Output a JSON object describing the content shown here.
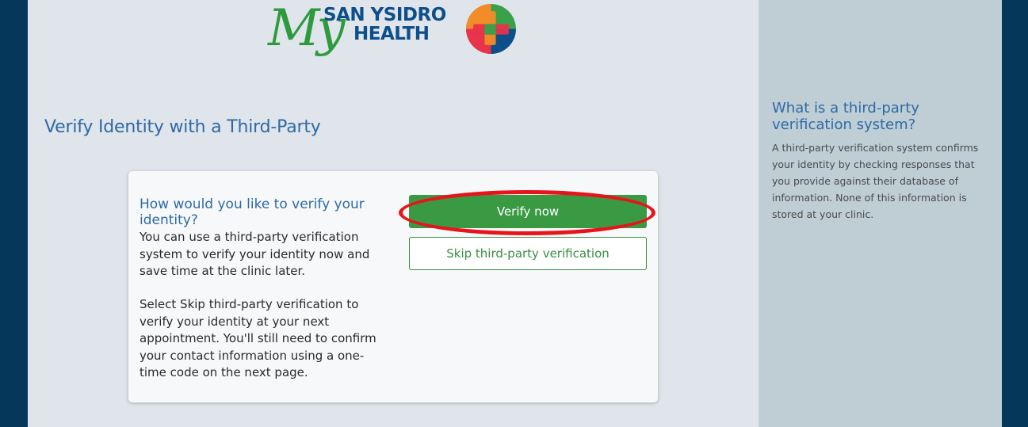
{
  "logo": {
    "my": "My",
    "line1": "SAN YSIDRO",
    "line2": "HEALTH",
    "badge_icon": "cross-badge-icon",
    "colors": {
      "green": "#2e9a3e",
      "blue": "#0d4f8b",
      "badge_red": "#e8334a",
      "badge_orange": "#f28c28",
      "badge_green": "#3aa14a",
      "badge_navy": "#0d4f8b"
    }
  },
  "main": {
    "title": "Verify Identity with a Third-Party",
    "card": {
      "heading": "How would you like to verify your identity?",
      "paragraph1": "You can use a third-party verification system to verify your identity now and save time at the clinic later.",
      "paragraph2": "Select Skip third-party verification to verify your identity at your next appointment. You'll still need to confirm your contact information using a one-time code on the next page.",
      "verify_label": "Verify now",
      "skip_label": "Skip third-party verification"
    }
  },
  "sidebar": {
    "title": "What is a third-party verification system?",
    "body": "A third-party verification system confirms your identity by checking responses that you provide against their database of information. None of this information is stored at your clinic."
  },
  "colors": {
    "page_bg": "#04375a",
    "main_bg": "#dfe5ea",
    "sidebar_bg": "#bfcdd5",
    "accent_blue": "#2e6aa6",
    "primary_green": "#3a9a44",
    "highlight_red": "#e8141b"
  }
}
